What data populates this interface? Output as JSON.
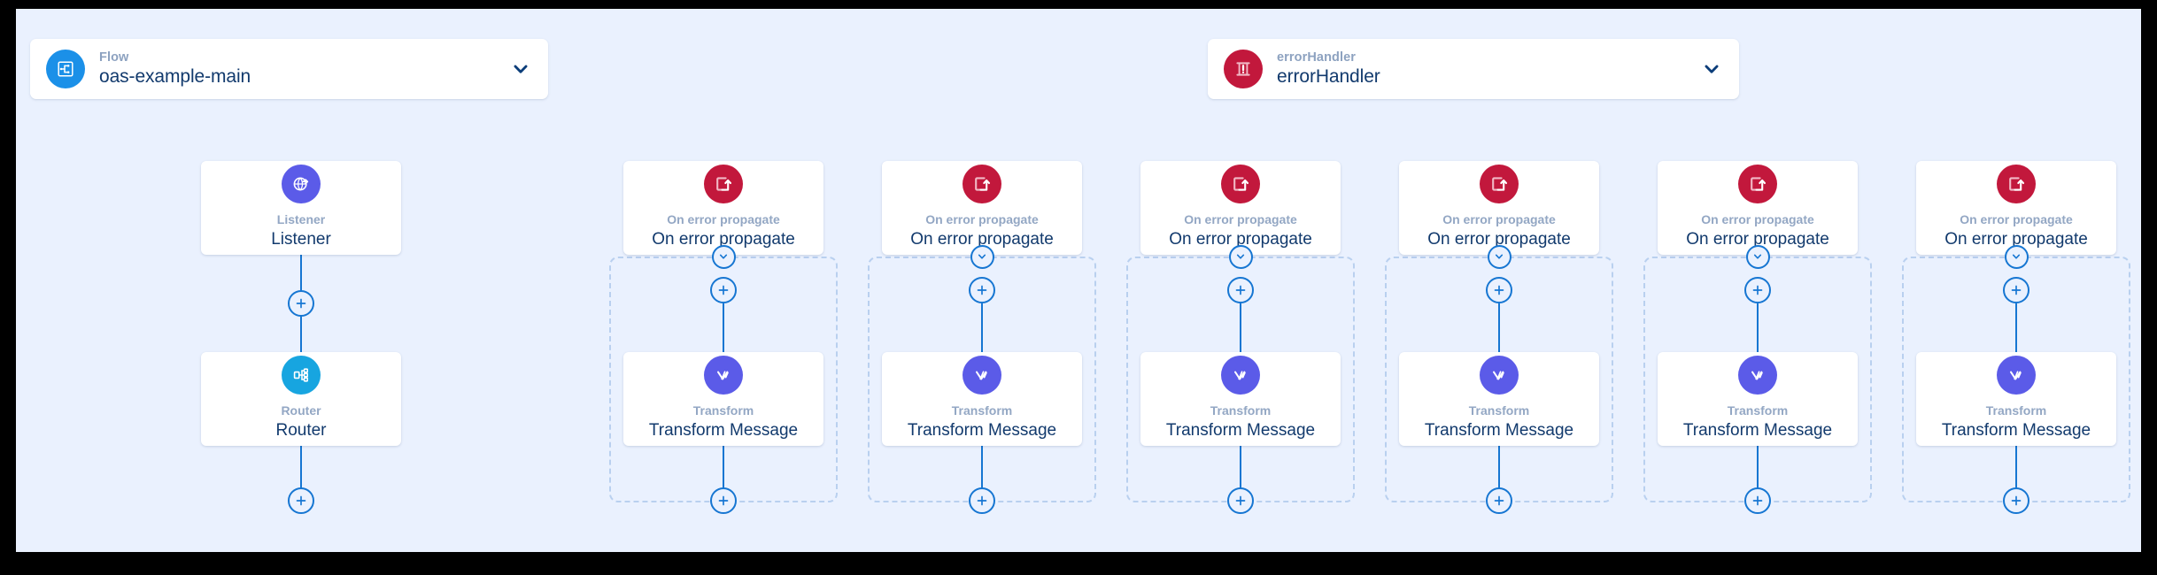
{
  "canvas": {
    "background_color": "#eaf1fe",
    "frame_color": "#000000"
  },
  "headers": [
    {
      "id": "flow",
      "kicker": "Flow",
      "title": "oas-example-main",
      "icon": "flow-icon",
      "icon_color": "#1b90e8",
      "chevron": "chevron-down-icon",
      "expanded": true
    },
    {
      "id": "errorHandler",
      "kicker": "errorHandler",
      "title": "errorHandler",
      "icon": "error-handler-icon",
      "icon_color": "#c2183c",
      "chevron": "chevron-down-icon",
      "expanded": true
    }
  ],
  "colors": {
    "listener_icon": "#5b5be8",
    "router_icon": "#17a5e0",
    "error_icon": "#c2183c",
    "transform_icon": "#5b5be8",
    "connector": "#1676d2",
    "scope_border": "#b9d0ef",
    "card_background": "#ffffff",
    "title_text": "#123a6d",
    "kicker_text": "#93a7c4"
  },
  "main_flow": {
    "name": "main-flow-column",
    "nodes": [
      {
        "kicker": "Listener",
        "title": "Listener",
        "icon": "listener-globe-icon",
        "icon_color": "#5b5be8"
      },
      {
        "kicker": "Router",
        "title": "Router",
        "icon": "router-split-icon",
        "icon_color": "#17a5e0"
      }
    ],
    "add_buttons": 2,
    "add_button_label": "+"
  },
  "error_columns": [
    {
      "index": 1,
      "handler": {
        "kicker": "On error propagate",
        "title": "On error propagate",
        "icon": "on-error-propagate-icon",
        "icon_color": "#c2183c"
      },
      "collapse": "chevron-down-icon",
      "scope_nodes": [
        {
          "kicker": "Transform",
          "title": "Transform Message",
          "icon": "transform-dataweave-icon",
          "icon_color": "#5b5be8"
        }
      ],
      "add_button_label": "+"
    },
    {
      "index": 2,
      "handler": {
        "kicker": "On error propagate",
        "title": "On error propagate",
        "icon": "on-error-propagate-icon",
        "icon_color": "#c2183c"
      },
      "collapse": "chevron-down-icon",
      "scope_nodes": [
        {
          "kicker": "Transform",
          "title": "Transform Message",
          "icon": "transform-dataweave-icon",
          "icon_color": "#5b5be8"
        }
      ],
      "add_button_label": "+"
    },
    {
      "index": 3,
      "handler": {
        "kicker": "On error propagate",
        "title": "On error propagate",
        "icon": "on-error-propagate-icon",
        "icon_color": "#c2183c"
      },
      "collapse": "chevron-down-icon",
      "scope_nodes": [
        {
          "kicker": "Transform",
          "title": "Transform Message",
          "icon": "transform-dataweave-icon",
          "icon_color": "#5b5be8"
        }
      ],
      "add_button_label": "+"
    },
    {
      "index": 4,
      "handler": {
        "kicker": "On error propagate",
        "title": "On error propagate",
        "icon": "on-error-propagate-icon",
        "icon_color": "#c2183c"
      },
      "collapse": "chevron-down-icon",
      "scope_nodes": [
        {
          "kicker": "Transform",
          "title": "Transform Message",
          "icon": "transform-dataweave-icon",
          "icon_color": "#5b5be8"
        }
      ],
      "add_button_label": "+"
    },
    {
      "index": 5,
      "handler": {
        "kicker": "On error propagate",
        "title": "On error propagate",
        "icon": "on-error-propagate-icon",
        "icon_color": "#c2183c"
      },
      "collapse": "chevron-down-icon",
      "scope_nodes": [
        {
          "kicker": "Transform",
          "title": "Transform Message",
          "icon": "transform-dataweave-icon",
          "icon_color": "#5b5be8"
        }
      ],
      "add_button_label": "+"
    },
    {
      "index": 6,
      "handler": {
        "kicker": "On error propagate",
        "title": "On error propagate",
        "icon": "on-error-propagate-icon",
        "icon_color": "#c2183c"
      },
      "collapse": "chevron-down-icon",
      "scope_nodes": [
        {
          "kicker": "Transform",
          "title": "Transform Message",
          "icon": "transform-dataweave-icon",
          "icon_color": "#5b5be8"
        }
      ],
      "add_button_label": "+"
    }
  ]
}
